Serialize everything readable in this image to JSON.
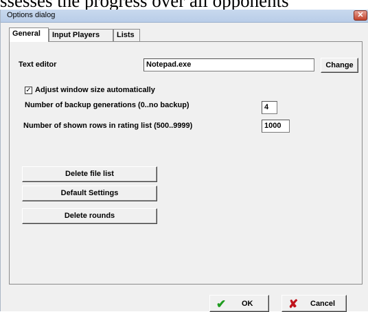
{
  "background_text": "ssesses the progress over all opponents",
  "window": {
    "title": "Options dialog"
  },
  "tabs": [
    {
      "label": "General",
      "active": true
    },
    {
      "label": "Input Players",
      "active": false
    },
    {
      "label": "Lists",
      "active": false
    }
  ],
  "general": {
    "text_editor_label": "Text editor",
    "text_editor_value": "Notepad.exe",
    "change_label": "Change",
    "adjust_window_label": "Adjust window size automatically",
    "adjust_window_checked": true,
    "adjust_window_mark": "✓",
    "backup_label": "Number of backup generations (0..no backup)",
    "backup_value": "4",
    "rows_label": "Number of shown rows in rating list (500..9999)",
    "rows_value": "1000",
    "delete_file_list_label": "Delete file list",
    "default_settings_label": "Default Settings",
    "delete_rounds_label": "Delete rounds"
  },
  "footer": {
    "ok_label": "OK",
    "cancel_label": "Cancel",
    "ok_icon": "green-checkmark-icon",
    "cancel_icon": "red-x-icon"
  },
  "colors": {
    "ok_icon": "#1f9c1f",
    "cancel_icon": "#c0141c",
    "close_button": "#c2432c"
  }
}
